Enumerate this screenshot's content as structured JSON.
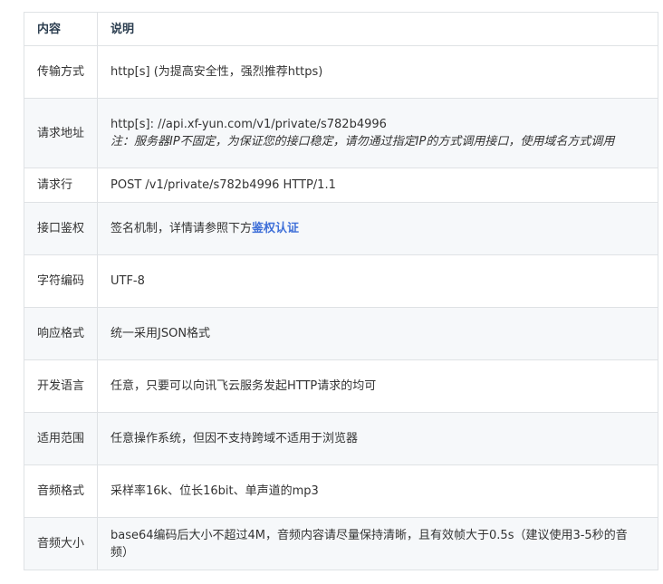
{
  "table": {
    "header": {
      "key": "内容",
      "value": "说明"
    },
    "rows": [
      {
        "key": "传输方式",
        "value": "http[s] (为提高安全性，强烈推荐https)"
      },
      {
        "key": "请求地址",
        "value": "http[s]: //api.xf-yun.com/v1/private/s782b4996",
        "note": "注：服务器IP不固定，为保证您的接口稳定，请勿通过指定IP的方式调用接口，使用域名方式调用"
      },
      {
        "key": "请求行",
        "value": "POST /v1/private/s782b4996 HTTP/1.1"
      },
      {
        "key": "接口鉴权",
        "value": "签名机制，详情请参照下方",
        "link": "鉴权认证"
      },
      {
        "key": "字符编码",
        "value": "UTF-8"
      },
      {
        "key": "响应格式",
        "value": "统一采用JSON格式"
      },
      {
        "key": "开发语言",
        "value": "任意，只要可以向讯飞云服务发起HTTP请求的均可"
      },
      {
        "key": "适用范围",
        "value": "任意操作系统，但因不支持跨域不适用于浏览器"
      },
      {
        "key": "音频格式",
        "value": "采样率16k、位长16bit、单声道的mp3"
      },
      {
        "key": "音频大小",
        "value": "base64编码后大小不超过4M，音频内容请尽量保持清晰，且有效帧大于0.5s（建议使用3-5秒的音频）"
      }
    ]
  }
}
